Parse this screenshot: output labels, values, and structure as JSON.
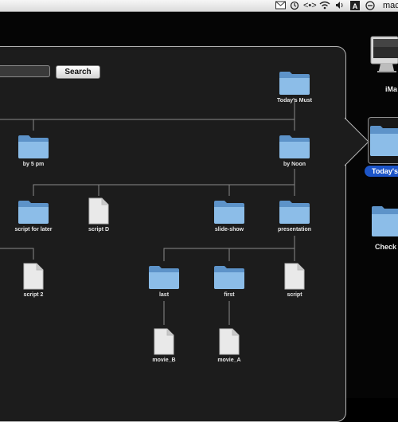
{
  "menubar": {
    "user": "mac",
    "icons": [
      "mail-icon",
      "time-machine-icon",
      "sync-icon",
      "wifi-icon",
      "volume-icon",
      "font-icon",
      "status-icon"
    ]
  },
  "search": {
    "value": "",
    "button_label": "Search"
  },
  "tree": {
    "todays_must": "Today's Must",
    "by_5pm": "by 5 pm",
    "by_noon": "by Noon",
    "script_for_later": "script for later",
    "script_d": "script D",
    "slide_show": "slide-show",
    "presentation": "presentation",
    "script_2": "script 2",
    "last": "last",
    "first": "first",
    "script": "script",
    "movie_b": "movie_B",
    "movie_a": "movie_A"
  },
  "desktop": {
    "imac_label": "iMa",
    "todays_label": "Today's",
    "check_label": "Check L"
  },
  "colors": {
    "accent": "#1d55c8",
    "folder": "#7fb3e2",
    "panel": "#1c1c1c"
  }
}
